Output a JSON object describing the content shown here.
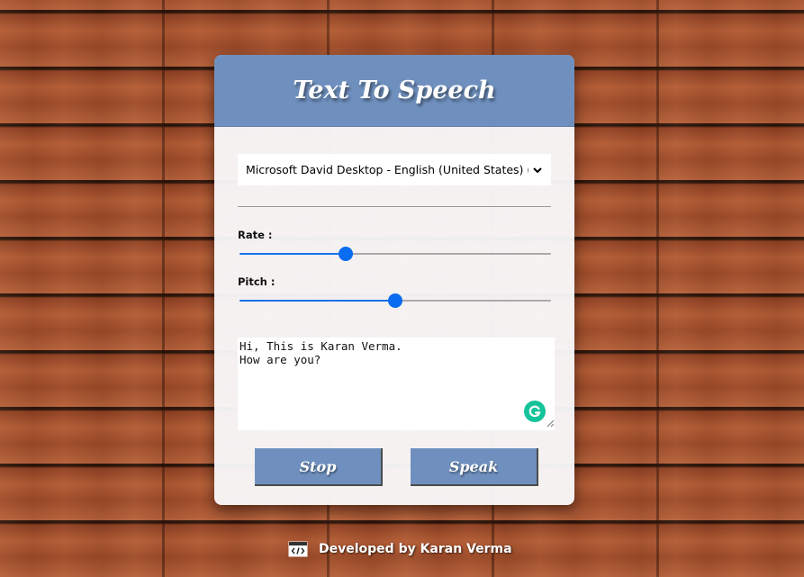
{
  "app": {
    "title": "Text To Speech"
  },
  "voice_select": {
    "selected": "Microsoft David Desktop - English (United States)   (en-US)"
  },
  "rate": {
    "label": "Rate :",
    "value_fraction": 0.34
  },
  "pitch": {
    "label": "Pitch :",
    "value_fraction": 0.5
  },
  "text_input": {
    "value": "Hi, This is Karan Verma.\nHow are you?"
  },
  "buttons": {
    "stop_label": "Stop",
    "speak_label": "Speak"
  },
  "footer": {
    "text": "Developed by Karan Verma",
    "icon": "code-window-icon"
  },
  "colors": {
    "accent": "#6f90be",
    "slider": "#0a6cf0",
    "grammarly": "#15c39a"
  }
}
